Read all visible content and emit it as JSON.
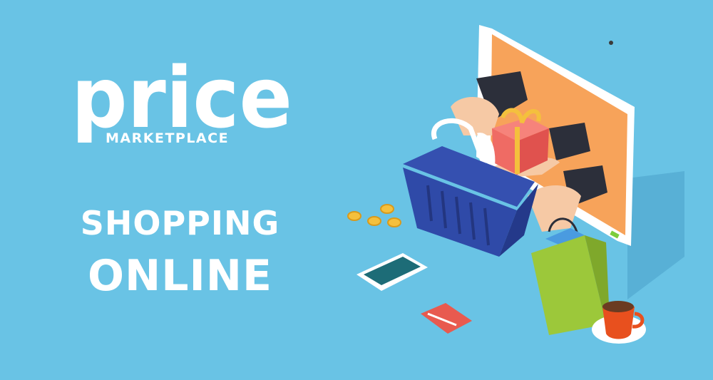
{
  "brand": {
    "name": "price",
    "tagline": "MARKETPLACE"
  },
  "headline": {
    "line1": "SHOPPING",
    "line2": "ONLINE"
  },
  "colors": {
    "background": "#69c3e5",
    "text": "#ffffff",
    "monitor_screen": "#f7a35a",
    "basket": "#2f4aa8",
    "shopping_bag": "#9cc83a",
    "cup": "#e8501e"
  },
  "icons": [
    "basket-icon",
    "gift-box-icon",
    "shopping-bag-icon",
    "phone-icon",
    "credit-card-icon",
    "coin-icon",
    "coffee-cup-icon",
    "monitor-icon"
  ]
}
